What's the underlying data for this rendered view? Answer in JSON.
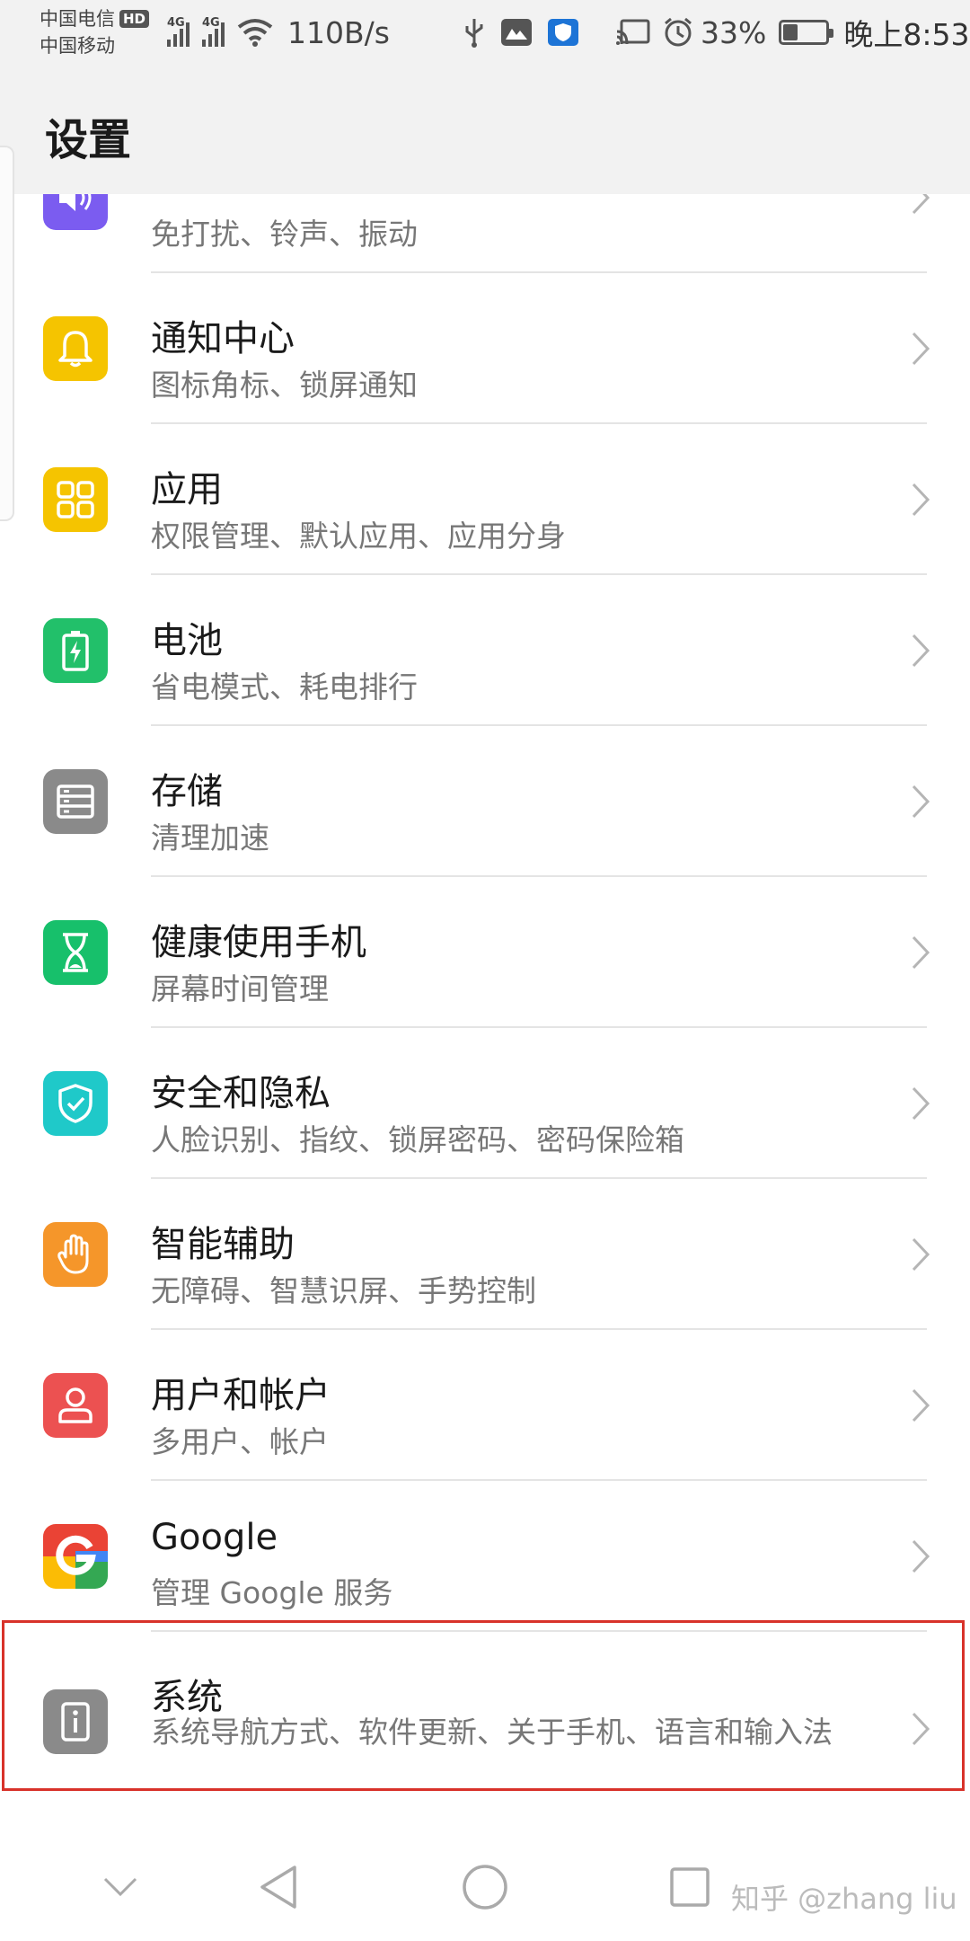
{
  "status_bar": {
    "carrier_1": "中国电信",
    "carrier_1_badge": "HD",
    "carrier_2": "中国移动",
    "signal_label_1": "4G",
    "signal_label_2": "4G",
    "net_speed": "110B/s",
    "battery_percent": "33%",
    "battery_level": 0.33,
    "time": "晚上8:53"
  },
  "header": {
    "title": "设置"
  },
  "items": [
    {
      "title": "",
      "subtitle": "免打扰、铃声、振动",
      "icon": "sound-icon",
      "color": "#7b5cf0"
    },
    {
      "title": "通知中心",
      "subtitle": "图标角标、锁屏通知",
      "icon": "bell-icon",
      "color": "#f5c400"
    },
    {
      "title": "应用",
      "subtitle": "权限管理、默认应用、应用分身",
      "icon": "apps-grid-icon",
      "color": "#f5c400"
    },
    {
      "title": "电池",
      "subtitle": "省电模式、耗电排行",
      "icon": "battery-icon",
      "color": "#22c06a"
    },
    {
      "title": "存储",
      "subtitle": "清理加速",
      "icon": "storage-icon",
      "color": "#8a8a8a"
    },
    {
      "title": "健康使用手机",
      "subtitle": "屏幕时间管理",
      "icon": "hourglass-icon",
      "color": "#17c06b"
    },
    {
      "title": "安全和隐私",
      "subtitle": "人脸识别、指纹、锁屏密码、密码保险箱",
      "icon": "shield-icon",
      "color": "#1fc9c9"
    },
    {
      "title": "智能辅助",
      "subtitle": "无障碍、智慧识屏、手势控制",
      "icon": "hand-icon",
      "color": "#f5962a"
    },
    {
      "title": "用户和帐户",
      "subtitle": "多用户、帐户",
      "icon": "user-icon",
      "color": "#ec5151"
    },
    {
      "title": "Google",
      "subtitle": "管理 Google 服务",
      "icon": "google-icon",
      "color": "#4285f4"
    },
    {
      "title": "系统",
      "subtitle": "系统导航方式、软件更新、关于手机、语言和输入法",
      "icon": "info-icon",
      "color": "#8a8a8a"
    }
  ],
  "nav_bar": {
    "watermark": "知乎 @zhang liu"
  },
  "colors": {
    "highlight": "#d8322a",
    "divider": "#e4e4e4",
    "chevron": "#b5b5b5"
  }
}
